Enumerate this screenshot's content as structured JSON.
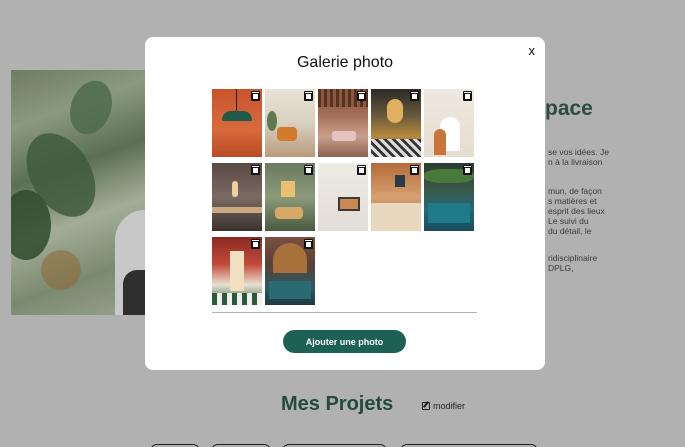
{
  "background": {
    "heading_partial": "pace",
    "text_lines": [
      "se vos idées. Je",
      "n à la livraison",
      "",
      "mun, de façon",
      "s matières et",
      "esprit des lieux",
      "Le suivi du",
      "du détail, le",
      "",
      "ridisciplinaire",
      "DPLG,"
    ],
    "projects_title": "Mes Projets",
    "modify_label": "modifier"
  },
  "modal": {
    "title": "Galerie photo",
    "close_label": "x",
    "photos": [
      {
        "name": "pendant-lamp"
      },
      {
        "name": "living-room-orange-chairs"
      },
      {
        "name": "restaurant-wooden-ceiling"
      },
      {
        "name": "room-hanging-lights"
      },
      {
        "name": "arch-wall-beige"
      },
      {
        "name": "dark-kitchen-light"
      },
      {
        "name": "green-wall-lounge"
      },
      {
        "name": "white-niche-shelf"
      },
      {
        "name": "orange-wall-bar"
      },
      {
        "name": "teal-bar-counter"
      },
      {
        "name": "red-dining-hall"
      },
      {
        "name": "arched-bar-interior"
      }
    ],
    "add_button_label": "Ajouter une photo"
  }
}
